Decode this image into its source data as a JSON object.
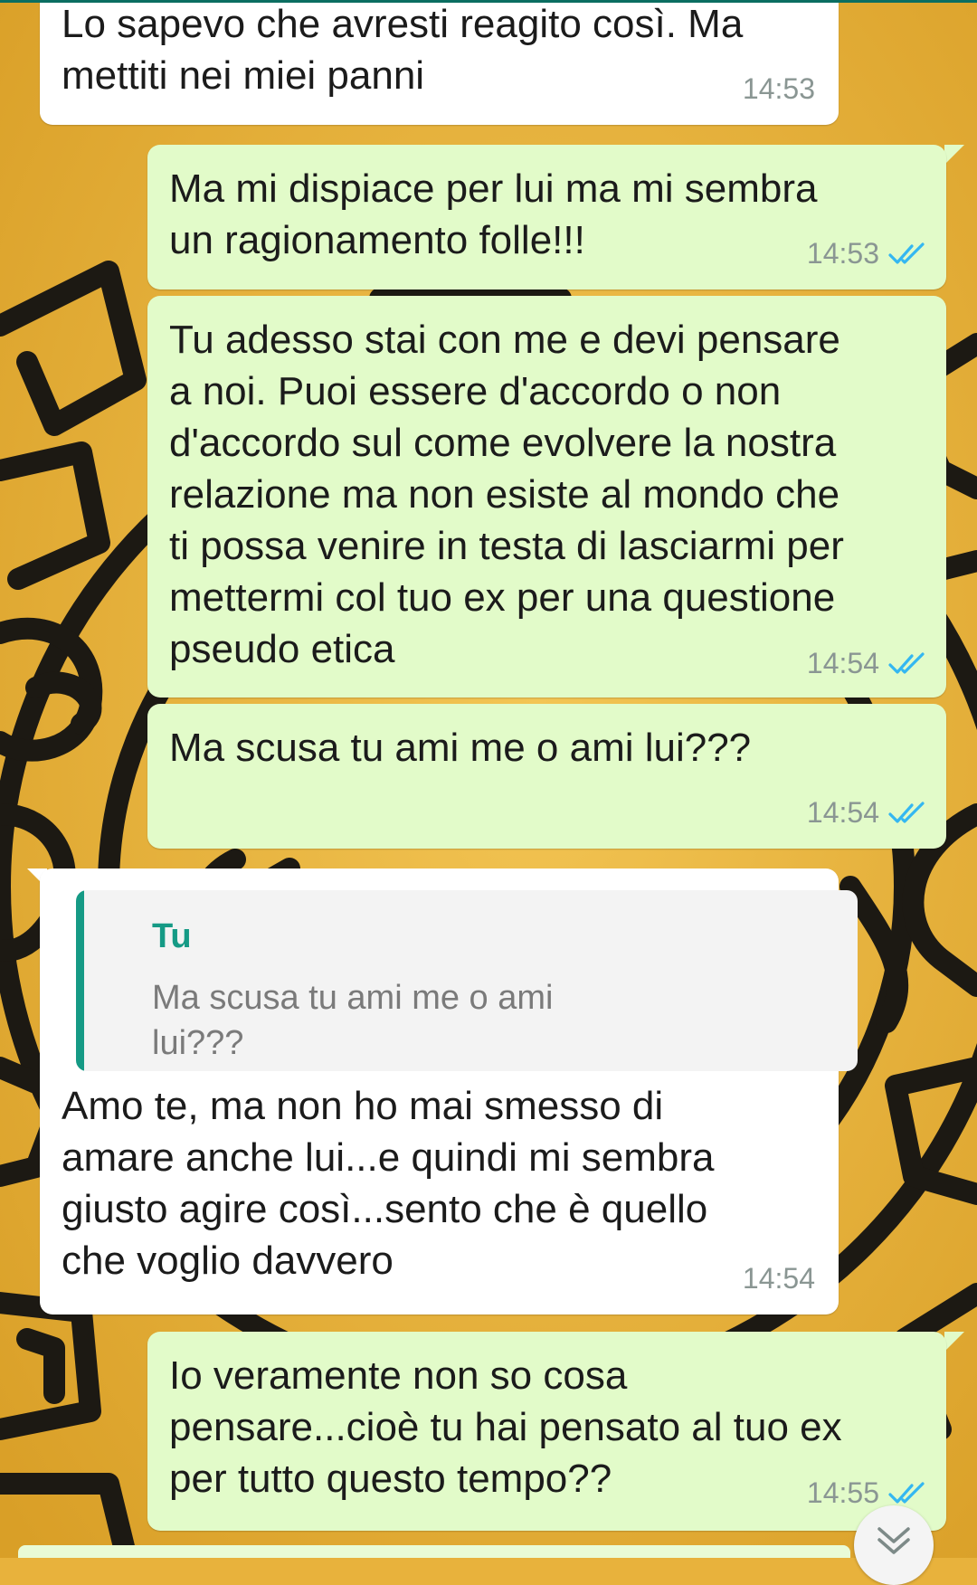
{
  "messages": [
    {
      "direction": "in",
      "text": "Lo sapevo che avresti reagito così. Ma\nmettiti nei miei panni",
      "time": "14:53"
    },
    {
      "direction": "out",
      "text": "Ma mi dispiace per lui ma mi sembra\nun ragionamento folle!!!",
      "time": "14:53",
      "status": "read"
    },
    {
      "direction": "out",
      "text": "Tu adesso stai con me e devi pensare\na noi. Puoi essere d'accordo o non\nd'accordo sul come evolvere la nostra\nrelazione ma non esiste al mondo che\nti possa venire in testa di lasciarmi per\nmettermi col tuo ex per una questione\npseudo etica",
      "time": "14:54",
      "status": "read"
    },
    {
      "direction": "out",
      "text": "Ma scusa tu ami me o ami lui???",
      "time": "14:54",
      "status": "read"
    },
    {
      "direction": "in",
      "reply_to": {
        "author": "Tu",
        "text": "Ma scusa tu ami me o ami\nlui???"
      },
      "text": "Amo te, ma non ho mai smesso di\namare anche lui...e quindi mi sembra\ngiusto agire così...sento che è quello\nche voglio davvero",
      "time": "14:54"
    },
    {
      "direction": "out",
      "text": "Io veramente non so cosa\npensare...cioè tu hai pensato al tuo ex\nper tutto questo tempo??",
      "time": "14:55",
      "status": "read"
    }
  ],
  "colors": {
    "incoming_bubble": "#ffffff",
    "outgoing_bubble": "#e2fbc9",
    "read_ticks": "#34b7f1",
    "quote_accent": "#159a85",
    "wallpaper": "#e8b23c"
  },
  "icons": {
    "read_receipt": "double-check-icon",
    "scroll_down": "chevron-down-icon"
  }
}
